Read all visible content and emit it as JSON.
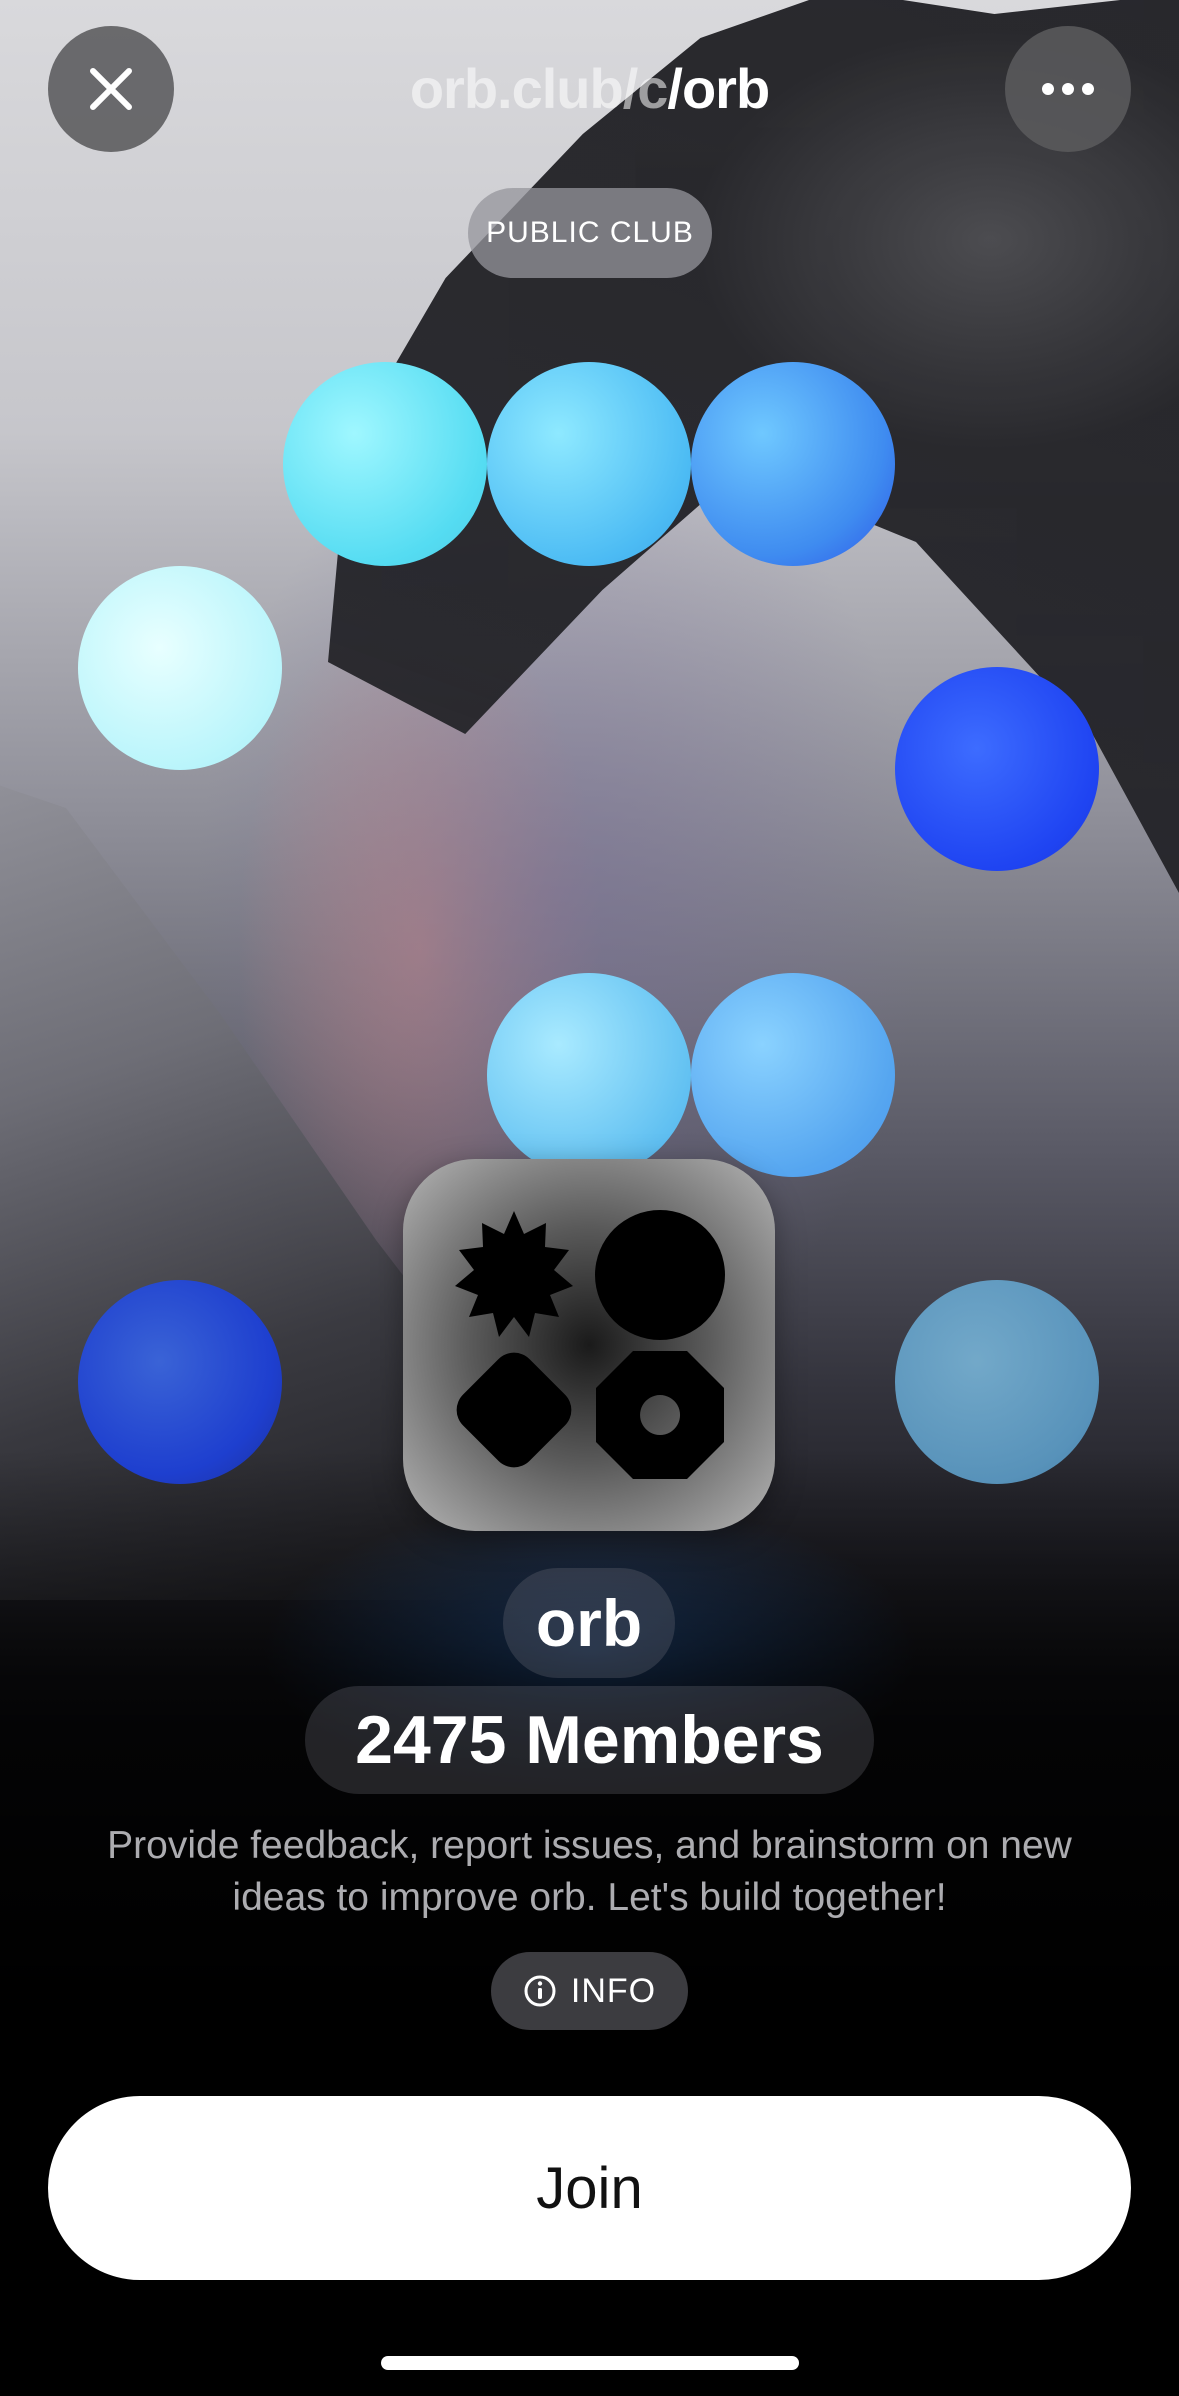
{
  "header": {
    "url_prefix": "orb.club/c",
    "url_slug": "/orb",
    "close_icon": "close-icon",
    "more_icon": "more-horizontal-icon"
  },
  "badge": {
    "label": "PUBLIC CLUB"
  },
  "club": {
    "name": "orb",
    "members": "2475 Members",
    "description": "Provide feedback, report issues, and brainstorm on new ideas to improve orb. Let's build together!",
    "logo_icon": "orb-shapes-logo"
  },
  "info_button": {
    "label": "INFO",
    "icon": "info-circle-icon"
  },
  "join_button": {
    "label": "Join"
  },
  "colors": {
    "button_bg": "#ffffff",
    "button_text": "#111111",
    "accent_blue": "#1f44f2",
    "accent_cyan": "#55dcf2"
  }
}
